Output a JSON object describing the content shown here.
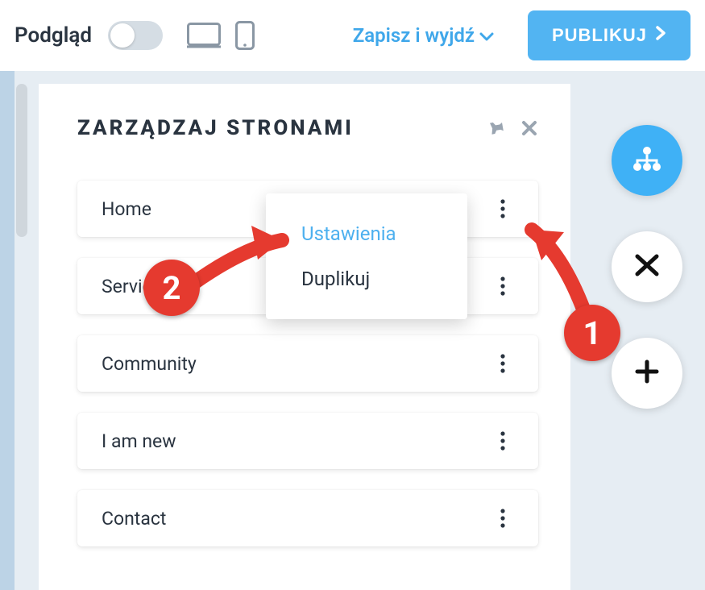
{
  "topbar": {
    "preview_label": "Podgląd",
    "save_label": "Zapisz i wyjdź",
    "publish_label": "PUBLIKUJ"
  },
  "panel": {
    "title": "ZARZĄDZAJ STRONAMI"
  },
  "pages": {
    "items": [
      {
        "label": "Home"
      },
      {
        "label": "Services"
      },
      {
        "label": "Community"
      },
      {
        "label": "I am new"
      },
      {
        "label": "Contact"
      }
    ]
  },
  "context_menu": {
    "settings_label": "Ustawienia",
    "duplicate_label": "Duplikuj"
  },
  "annotations": {
    "badge1": "1",
    "badge2": "2"
  },
  "colors": {
    "accent_blue": "#3fb1f6",
    "annotation_red": "#e53a2f",
    "text_dark": "#2a3440"
  }
}
